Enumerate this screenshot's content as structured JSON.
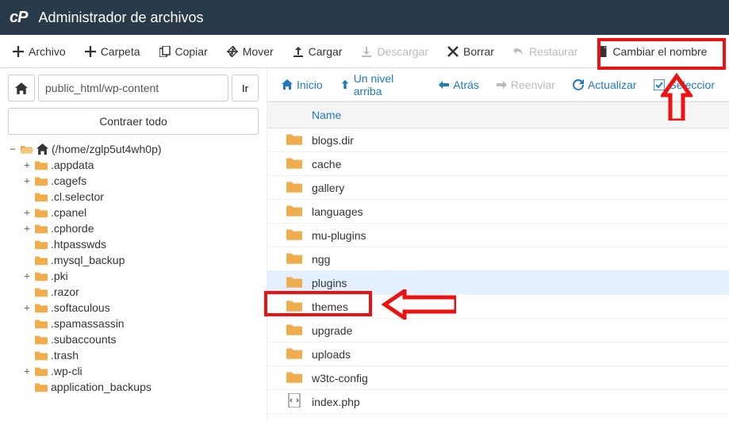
{
  "header": {
    "logo": "cP",
    "title": "Administrador de archivos"
  },
  "toolbar1": {
    "file": "Archivo",
    "folder": "Carpeta",
    "copy": "Copiar",
    "move": "Mover",
    "upload": "Cargar",
    "download": "Descargar",
    "delete": "Borrar",
    "restore": "Restaurar",
    "rename": "Cambiar el nombre"
  },
  "path": {
    "value": "public_html/wp-content",
    "go": "Ir"
  },
  "collapse_all": "Contraer todo",
  "tree": {
    "root": "(/home/zglp5ut4wh0p)",
    "items": [
      {
        "label": ".appdata",
        "expandable": true
      },
      {
        "label": ".cagefs",
        "expandable": true
      },
      {
        "label": ".cl.selector",
        "expandable": false
      },
      {
        "label": ".cpanel",
        "expandable": true
      },
      {
        "label": ".cphorde",
        "expandable": true
      },
      {
        "label": ".htpasswds",
        "expandable": false
      },
      {
        "label": ".mysql_backup",
        "expandable": false
      },
      {
        "label": ".pki",
        "expandable": true
      },
      {
        "label": ".razor",
        "expandable": false
      },
      {
        "label": ".softaculous",
        "expandable": true
      },
      {
        "label": ".spamassassin",
        "expandable": false
      },
      {
        "label": ".subaccounts",
        "expandable": false
      },
      {
        "label": ".trash",
        "expandable": false
      },
      {
        "label": ".wp-cli",
        "expandable": true
      },
      {
        "label": "application_backups",
        "expandable": false
      }
    ]
  },
  "toolbar2": {
    "home": "Inicio",
    "up": "Un nivel arriba",
    "back": "Atrás",
    "forward": "Reenviar",
    "reload": "Actualizar",
    "select_all": "Seleccior"
  },
  "list": {
    "header_name": "Name",
    "rows": [
      {
        "name": "blogs.dir",
        "type": "folder"
      },
      {
        "name": "cache",
        "type": "folder"
      },
      {
        "name": "gallery",
        "type": "folder"
      },
      {
        "name": "languages",
        "type": "folder"
      },
      {
        "name": "mu-plugins",
        "type": "folder"
      },
      {
        "name": "ngg",
        "type": "folder"
      },
      {
        "name": "plugins",
        "type": "folder",
        "selected": true
      },
      {
        "name": "themes",
        "type": "folder"
      },
      {
        "name": "upgrade",
        "type": "folder"
      },
      {
        "name": "uploads",
        "type": "folder"
      },
      {
        "name": "w3tc-config",
        "type": "folder"
      },
      {
        "name": "index.php",
        "type": "file"
      }
    ]
  },
  "colors": {
    "accent": "#1f7ac3",
    "header_bg": "#293a4a",
    "folder": "#f0ad4e",
    "anno": "#e11"
  }
}
